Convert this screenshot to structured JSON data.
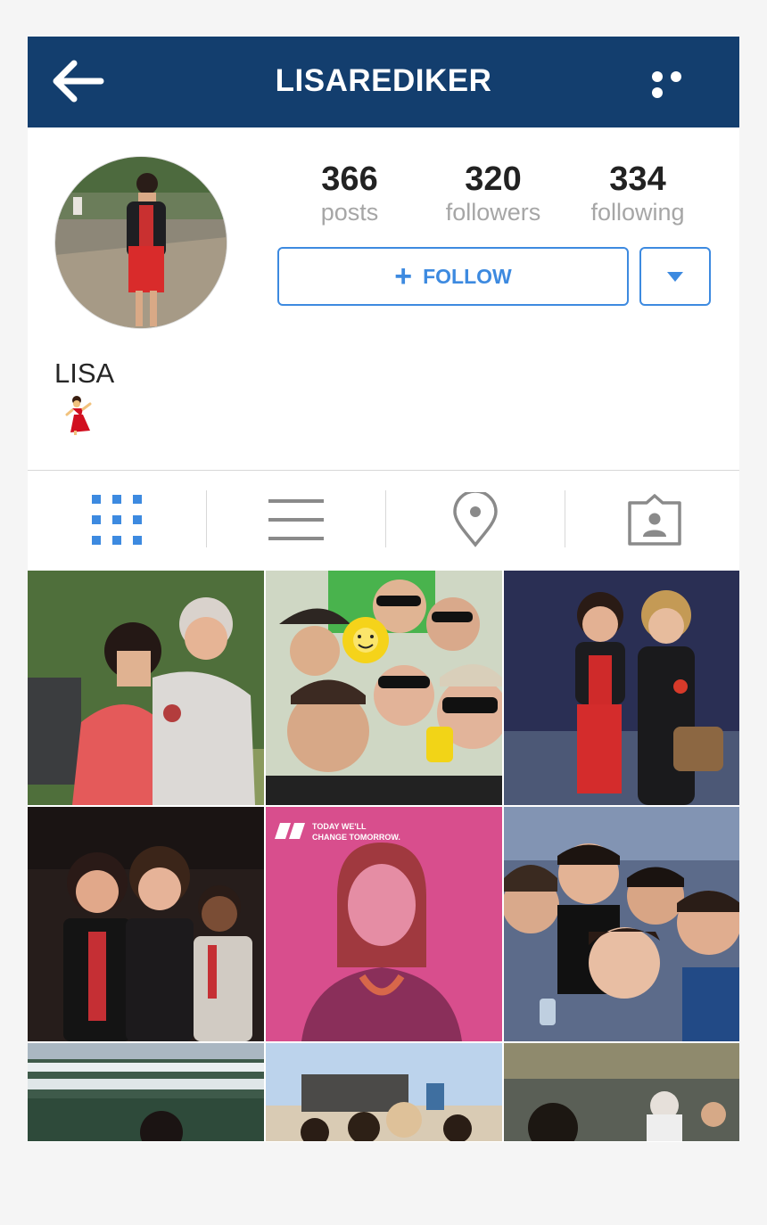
{
  "header": {
    "username": "LISAREDIKER"
  },
  "stats": {
    "posts": {
      "value": "366",
      "label": "posts"
    },
    "followers": {
      "value": "320",
      "label": "followers"
    },
    "following": {
      "value": "334",
      "label": "following"
    }
  },
  "actions": {
    "follow_label": "FOLLOW"
  },
  "profile": {
    "display_name": "LISA"
  },
  "colors": {
    "header_bg": "#133e6e",
    "accent": "#3d8ae0",
    "secondary_text": "#a6a6a6",
    "icon_gray": "#888888"
  },
  "tabs": [
    {
      "name": "grid",
      "icon": "grid-icon",
      "active": true
    },
    {
      "name": "list",
      "icon": "list-icon",
      "active": false
    },
    {
      "name": "places",
      "icon": "location-pin-icon",
      "active": false
    },
    {
      "name": "tagged",
      "icon": "tagged-photos-icon",
      "active": false
    }
  ],
  "overlay_texts": {
    "campaign_line1": "TODAY WE'LL",
    "campaign_line2": "CHANGE TOMORROW."
  }
}
